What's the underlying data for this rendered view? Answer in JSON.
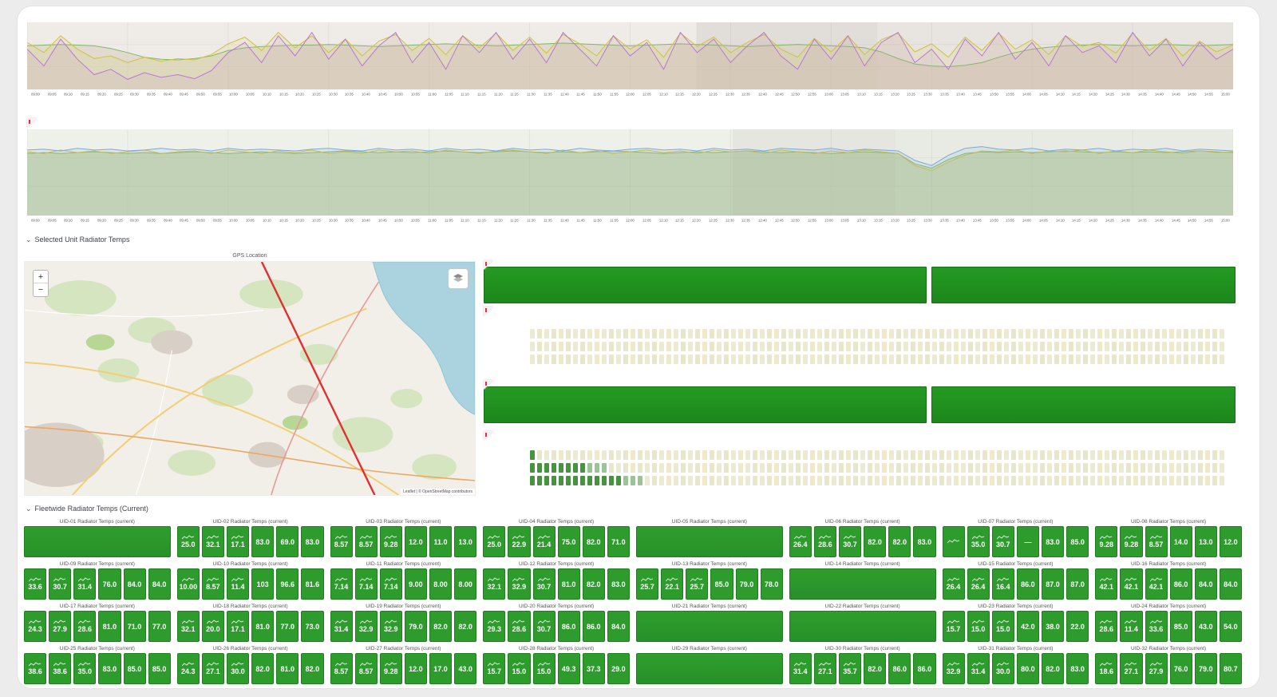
{
  "header1": {
    "label": "Selected Unit Radiator Temps"
  },
  "header2": {
    "label": "Fleetwide Radiator Temps (Current)"
  },
  "map": {
    "title": "GPS Location",
    "zoom_in": "+",
    "zoom_out": "−",
    "attribution": "Leaflet | © OpenStreetMap contributors"
  },
  "colors": {
    "stat_green": "#2e9c2d",
    "gauge_green": "#1f8c1f",
    "hist_pale": "#ecead3",
    "hist_dark": "#47933f",
    "series_purple": "#b877d9",
    "series_yellow": "#cfc23e",
    "series_green": "#82b66b",
    "series_blue": "#7da9d8",
    "gps_track_red": "#e03030",
    "map_water": "#aad3df"
  },
  "time_ticks": [
    "09:00",
    "09:05",
    "09:10",
    "09:15",
    "09:20",
    "09:25",
    "09:30",
    "09:35",
    "09:40",
    "09:45",
    "09:50",
    "09:55",
    "10:00",
    "10:05",
    "10:10",
    "10:15",
    "10:20",
    "10:25",
    "10:30",
    "10:35",
    "10:40",
    "10:45",
    "10:50",
    "10:55",
    "11:00",
    "11:05",
    "11:10",
    "11:15",
    "11:20",
    "11:25",
    "11:30",
    "11:35",
    "11:40",
    "11:45",
    "11:50",
    "11:55",
    "12:00",
    "12:05",
    "12:10",
    "12:15",
    "12:20",
    "12:25",
    "12:30",
    "12:35",
    "12:40",
    "12:45",
    "12:50",
    "12:55",
    "13:00",
    "13:05",
    "13:10",
    "13:15",
    "13:20",
    "13:25",
    "13:30",
    "13:35",
    "13:40",
    "13:45",
    "13:50",
    "13:55",
    "14:00",
    "14:05",
    "14:10",
    "14:15",
    "14:20",
    "14:25",
    "14:30",
    "14:35",
    "14:40",
    "14:45",
    "14:50",
    "14:55",
    "15:00"
  ],
  "chart_data": [
    {
      "type": "line",
      "title": "",
      "xlabel": "time",
      "ylabel": "",
      "ylim": [
        0,
        100
      ],
      "grid": true,
      "legend": "none",
      "bg": "#efebe7",
      "bands": [
        {
          "from": 0.555,
          "to": 0.705,
          "color": "rgba(110,100,90,0.10)"
        },
        {
          "from": 0.705,
          "to": 1.0,
          "color": "rgba(110,100,90,0.05)"
        }
      ],
      "series": [
        {
          "name": "green",
          "color": "#82b66b",
          "fill": "rgba(214,206,188,0.55)",
          "values": [
            65,
            66,
            67,
            66,
            65,
            61,
            55,
            48,
            45,
            44,
            46,
            50,
            58,
            62,
            64,
            65,
            66,
            66,
            67,
            66,
            65,
            64,
            65,
            66,
            67,
            68,
            67,
            66,
            65,
            66,
            67,
            68,
            69,
            68,
            67,
            66,
            65,
            66,
            67,
            68,
            67,
            66,
            65,
            64,
            65,
            66,
            67,
            66,
            65,
            64,
            62,
            56,
            46,
            38,
            35,
            34,
            36,
            40,
            48,
            55,
            60,
            63,
            65,
            66,
            67,
            66,
            65,
            66,
            67,
            66,
            65,
            66,
            67
          ]
        },
        {
          "name": "yellow",
          "color": "#cfc23e",
          "fill": "rgba(207,194,62,0.12)",
          "values": [
            70,
            55,
            80,
            60,
            46,
            50,
            40,
            48,
            42,
            46,
            44,
            52,
            68,
            78,
            58,
            85,
            62,
            80,
            55,
            75,
            50,
            72,
            82,
            58,
            76,
            52,
            80,
            62,
            84,
            58,
            78,
            54,
            82,
            68,
            50,
            80,
            60,
            74,
            48,
            84,
            64,
            78,
            55,
            70,
            82,
            60,
            48,
            76,
            56,
            80,
            52,
            74,
            84,
            56,
            68,
            48,
            78,
            58,
            84,
            60,
            74,
            52,
            80,
            64,
            70,
            54,
            84,
            58,
            76,
            50,
            72,
            56,
            66
          ]
        },
        {
          "name": "purple",
          "color": "#b877d9",
          "fill": "rgba(184,119,217,0.10)",
          "values": [
            60,
            35,
            75,
            45,
            22,
            30,
            15,
            25,
            18,
            22,
            16,
            28,
            55,
            70,
            40,
            80,
            50,
            85,
            45,
            75,
            35,
            65,
            85,
            40,
            70,
            30,
            80,
            55,
            85,
            45,
            75,
            40,
            85,
            60,
            35,
            80,
            50,
            70,
            30,
            85,
            55,
            75,
            40,
            65,
            85,
            50,
            30,
            75,
            45,
            80,
            35,
            70,
            85,
            40,
            60,
            30,
            75,
            50,
            85,
            45,
            70,
            35,
            80,
            55,
            65,
            40,
            85,
            50,
            75,
            35,
            70,
            45,
            60
          ]
        }
      ]
    },
    {
      "type": "line",
      "title": "",
      "xlabel": "time",
      "ylabel": "",
      "ylim": [
        0,
        100
      ],
      "grid": true,
      "legend": "none",
      "bg": "#eef0ea",
      "bands": [
        {
          "from": 0.585,
          "to": 0.72,
          "color": "rgba(110,100,90,0.07)"
        },
        {
          "from": 0.72,
          "to": 1.0,
          "color": "rgba(140,150,120,0.05)"
        }
      ],
      "series": [
        {
          "name": "green",
          "color": "#86b878",
          "fill": "rgba(134,184,120,0.30)",
          "values": [
            72,
            73,
            72,
            73,
            74,
            73,
            72,
            73,
            72,
            73,
            74,
            73,
            72,
            73,
            74,
            73,
            72,
            73,
            74,
            75,
            74,
            73,
            74,
            73,
            74,
            75,
            74,
            73,
            74,
            75,
            74,
            73,
            74,
            73,
            74,
            75,
            74,
            73,
            72,
            73,
            74,
            73,
            74,
            75,
            74,
            73,
            74,
            73,
            72,
            73,
            74,
            73,
            72,
            60,
            55,
            65,
            72,
            74,
            73,
            74,
            73,
            74,
            75,
            74,
            73,
            74,
            73,
            74,
            73,
            74,
            75,
            74,
            73
          ]
        },
        {
          "name": "yellow",
          "color": "#cfc23e",
          "fill": "rgba(207,194,62,0.15)",
          "values": [
            74,
            72,
            76,
            73,
            75,
            72,
            74,
            76,
            72,
            74,
            75,
            72,
            76,
            74,
            72,
            75,
            73,
            76,
            72,
            74,
            72,
            76,
            74,
            75,
            72,
            76,
            74,
            72,
            75,
            76,
            74,
            72,
            76,
            73,
            75,
            72,
            74,
            76,
            73,
            75,
            72,
            76,
            74,
            75,
            72,
            76,
            74,
            72,
            75,
            73,
            76,
            74,
            72,
            58,
            52,
            62,
            70,
            75,
            74,
            76,
            72,
            75,
            74,
            76,
            72,
            75,
            73,
            76,
            74,
            72,
            75,
            73,
            74
          ]
        },
        {
          "name": "blue",
          "color": "#7da9d8",
          "fill": "rgba(125,169,216,0.15)",
          "values": [
            76,
            77,
            75,
            78,
            76,
            77,
            75,
            76,
            78,
            76,
            77,
            75,
            78,
            76,
            77,
            76,
            75,
            77,
            78,
            76,
            75,
            78,
            76,
            77,
            75,
            78,
            76,
            77,
            75,
            78,
            76,
            77,
            75,
            78,
            76,
            75,
            77,
            78,
            76,
            77,
            75,
            78,
            76,
            77,
            75,
            78,
            77,
            76,
            78,
            75,
            77,
            76,
            75,
            64,
            58,
            70,
            78,
            80,
            77,
            76,
            78,
            75,
            77,
            76,
            78,
            75,
            77,
            76,
            78,
            75,
            77,
            76,
            75
          ]
        }
      ]
    },
    {
      "type": "bar",
      "title": "",
      "orientation": "horizontal",
      "segments_pct": [
        59.3,
        40.7
      ],
      "values": [
        100,
        100
      ],
      "color": "#1f8c1f"
    },
    {
      "type": "heatmap",
      "title": "",
      "rows": 3,
      "cells": 97,
      "dark_counts": [
        0,
        0,
        0
      ]
    },
    {
      "type": "bar",
      "title": "",
      "orientation": "horizontal",
      "segments_pct": [
        59.3,
        40.7
      ],
      "values": [
        100,
        100
      ],
      "color": "#1f8c1f"
    },
    {
      "type": "heatmap",
      "title": "",
      "rows": 3,
      "cells": 97,
      "dark_counts": [
        1,
        11,
        16
      ]
    }
  ],
  "stat_grid": {
    "panels": [
      {
        "title": "UID-01 Radiator Temps (current)",
        "type": "solid",
        "values": []
      },
      {
        "title": "UID-02 Radiator Temps (current)",
        "type": "stats",
        "values": [
          "25.0",
          "32.1",
          "17.1",
          "83.0",
          "69.0",
          "83.0"
        ]
      },
      {
        "title": "UID-03 Radiator Temps (current)",
        "type": "stats",
        "values": [
          "8.57",
          "8.57",
          "9.28",
          "12.0",
          "11.0",
          "13.0"
        ]
      },
      {
        "title": "UID-04 Radiator Temps (current)",
        "type": "stats",
        "values": [
          "25.0",
          "22.9",
          "21.4",
          "75.0",
          "82.0",
          "71.0"
        ]
      },
      {
        "title": "UID-05 Radiator Temps (current)",
        "type": "solid",
        "values": []
      },
      {
        "title": "UID-06 Radiator Temps (current)",
        "type": "stats",
        "values": [
          "26.4",
          "28.6",
          "30.7",
          "82.0",
          "82.0",
          "83.0"
        ]
      },
      {
        "title": "UID-07 Radiator Temps (current)",
        "type": "stats",
        "values": [
          "",
          "35.0",
          "30.7",
          "—",
          "83.0",
          "85.0"
        ]
      },
      {
        "title": "UID-08 Radiator Temps (current)",
        "type": "stats",
        "values": [
          "9.28",
          "9.28",
          "8.57",
          "14.0",
          "13.0",
          "12.0"
        ]
      },
      {
        "title": "UID-09 Radiator Temps (current)",
        "type": "stats",
        "values": [
          "33.6",
          "30.7",
          "31.4",
          "76.0",
          "84.0",
          "84.0"
        ]
      },
      {
        "title": "UID-10 Radiator Temps (current)",
        "type": "stats",
        "values": [
          "10.00",
          "8.57",
          "11.4",
          "103",
          "96.6",
          "81.6"
        ]
      },
      {
        "title": "UID-11 Radiator Temps (current)",
        "type": "stats",
        "values": [
          "7.14",
          "7.14",
          "7.14",
          "9.00",
          "8.00",
          "8.00"
        ]
      },
      {
        "title": "UID-12 Radiator Temps (current)",
        "type": "stats",
        "values": [
          "32.1",
          "32.9",
          "30.7",
          "81.0",
          "82.0",
          "83.0"
        ]
      },
      {
        "title": "UID-13 Radiator Temps (current)",
        "type": "stats",
        "values": [
          "25.7",
          "22.1",
          "25.7",
          "85.0",
          "79.0",
          "78.0"
        ]
      },
      {
        "title": "UID-14 Radiator Temps (current)",
        "type": "solid",
        "values": []
      },
      {
        "title": "UID-15 Radiator Temps (current)",
        "type": "stats",
        "values": [
          "26.4",
          "26.4",
          "16.4",
          "86.0",
          "87.0",
          "87.0"
        ]
      },
      {
        "title": "UID-16 Radiator Temps (current)",
        "type": "stats",
        "values": [
          "42.1",
          "42.1",
          "42.1",
          "86.0",
          "84.0",
          "84.0"
        ]
      },
      {
        "title": "UID-17 Radiator Temps (current)",
        "type": "stats",
        "values": [
          "24.3",
          "27.9",
          "28.6",
          "81.0",
          "71.0",
          "77.0"
        ]
      },
      {
        "title": "UID-18 Radiator Temps (current)",
        "type": "stats",
        "values": [
          "32.1",
          "20.0",
          "17.1",
          "81.0",
          "77.0",
          "73.0"
        ]
      },
      {
        "title": "UID-19 Radiator Temps (current)",
        "type": "stats",
        "values": [
          "31.4",
          "32.9",
          "32.9",
          "79.0",
          "82.0",
          "82.0"
        ]
      },
      {
        "title": "UID-20 Radiator Temps (current)",
        "type": "stats",
        "values": [
          "29.3",
          "28.6",
          "30.7",
          "86.0",
          "86.0",
          "84.0"
        ]
      },
      {
        "title": "UID-21 Radiator Temps (current)",
        "type": "solid",
        "values": []
      },
      {
        "title": "UID-22 Radiator Temps (current)",
        "type": "solid",
        "values": []
      },
      {
        "title": "UID-23 Radiator Temps (current)",
        "type": "stats",
        "values": [
          "15.7",
          "15.0",
          "15.0",
          "42.0",
          "38.0",
          "22.0"
        ]
      },
      {
        "title": "UID-24 Radiator Temps (current)",
        "type": "stats",
        "values": [
          "28.6",
          "11.4",
          "33.6",
          "85.0",
          "43.0",
          "54.0"
        ]
      },
      {
        "title": "UID-25 Radiator Temps (current)",
        "type": "stats",
        "values": [
          "38.6",
          "38.6",
          "35.0",
          "83.0",
          "85.0",
          "85.0"
        ]
      },
      {
        "title": "UID-26 Radiator Temps (current)",
        "type": "stats",
        "values": [
          "24.3",
          "27.1",
          "30.0",
          "82.0",
          "81.0",
          "82.0"
        ]
      },
      {
        "title": "UID-27 Radiator Temps (current)",
        "type": "stats",
        "values": [
          "8.57",
          "8.57",
          "9.28",
          "12.0",
          "17.0",
          "43.0"
        ]
      },
      {
        "title": "UID-28 Radiator Temps (current)",
        "type": "stats",
        "values": [
          "15.7",
          "15.0",
          "15.0",
          "49.3",
          "37.3",
          "29.0"
        ]
      },
      {
        "title": "UID-29 Radiator Temps (current)",
        "type": "solid",
        "values": []
      },
      {
        "title": "UID-30 Radiator Temps (current)",
        "type": "stats",
        "values": [
          "31.4",
          "27.1",
          "35.7",
          "82.0",
          "86.0",
          "86.0"
        ]
      },
      {
        "title": "UID-31 Radiator Temps (current)",
        "type": "stats",
        "values": [
          "32.9",
          "31.4",
          "30.0",
          "80.0",
          "82.0",
          "83.0"
        ]
      },
      {
        "title": "UID-32 Radiator Temps (current)",
        "type": "stats",
        "values": [
          "18.6",
          "27.1",
          "27.9",
          "76.0",
          "79.0",
          "80.7"
        ]
      }
    ]
  }
}
